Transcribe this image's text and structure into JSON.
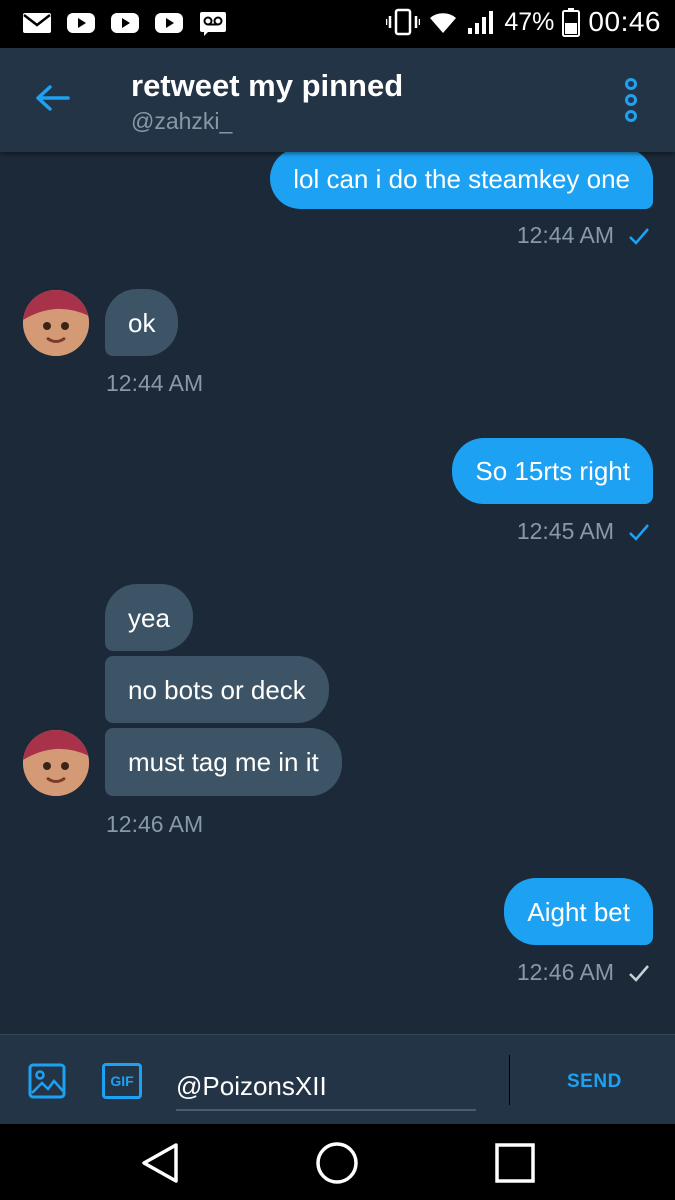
{
  "status_bar": {
    "battery": "47%",
    "time": "00:46",
    "left_icons": [
      "mail-icon",
      "youtube-icon",
      "youtube-icon",
      "youtube-icon",
      "voicemail-icon"
    ],
    "right_icons": [
      "vibrate-icon",
      "wifi-icon",
      "signal-icon",
      "battery-icon"
    ]
  },
  "header": {
    "title": "retweet my pinned",
    "handle": "@zahzki_"
  },
  "messages": [
    {
      "dir": "out",
      "text": "lol can i do the steamkey one",
      "time": "12:44 AM",
      "read": true
    },
    {
      "dir": "in",
      "text": "ok",
      "time": "12:44 AM"
    },
    {
      "dir": "out",
      "text": "So 15rts right",
      "time": "12:45 AM",
      "read": true
    },
    {
      "dir": "in",
      "text": "yea"
    },
    {
      "dir": "in",
      "text": "no bots or deck"
    },
    {
      "dir": "in",
      "text": "must tag me in it",
      "time": "12:46 AM"
    },
    {
      "dir": "out",
      "text": "Aight bet",
      "time": "12:46 AM",
      "read": false
    }
  ],
  "composer": {
    "input_value": "@PoizonsXII",
    "gif_label": "GIF",
    "send_label": "SEND"
  },
  "colors": {
    "accent": "#1da1f2",
    "background": "#1c2938",
    "header": "#243447",
    "incoming_bubble": "#3d5466",
    "meta_text": "#8899a6"
  }
}
